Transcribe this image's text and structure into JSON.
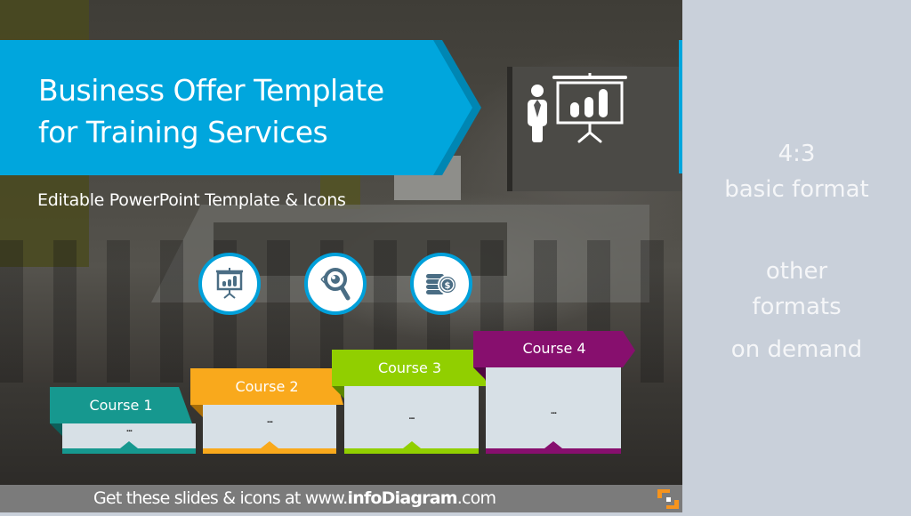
{
  "title": {
    "line1": "Business Offer Template",
    "line2": "for Training Services"
  },
  "subtitle": "Editable PowerPoint Template & Icons",
  "icons": {
    "header": "presenter-with-chart-icon",
    "circles": [
      "presentation-board-icon",
      "eye-magnifier-icon",
      "coins-dollar-icon"
    ]
  },
  "courses": [
    {
      "label": "Course 1",
      "content": "...",
      "color": "#16988f",
      "dark": "#0d5f5a"
    },
    {
      "label": "Course 2",
      "content": "...",
      "color": "#f9a91c",
      "dark": "#a86d08"
    },
    {
      "label": "Course 3",
      "content": "...",
      "color": "#91cf00",
      "dark": "#5c8600"
    },
    {
      "label": "Course 4",
      "content": "...",
      "color": "#870f6e",
      "dark": "#4f0640"
    }
  ],
  "footer": {
    "prefix": "Get these slides & icons at www.",
    "brand": "infoDiagram",
    "suffix": ".com"
  },
  "side_panel": {
    "ratio": "4:3",
    "basic": "basic format",
    "other1": "other",
    "other2": "formats",
    "other3": "on demand"
  },
  "colors": {
    "accent_blue": "#00a6dd",
    "logo_orange": "#f7941d",
    "panel_bg": "#c9d0da"
  }
}
